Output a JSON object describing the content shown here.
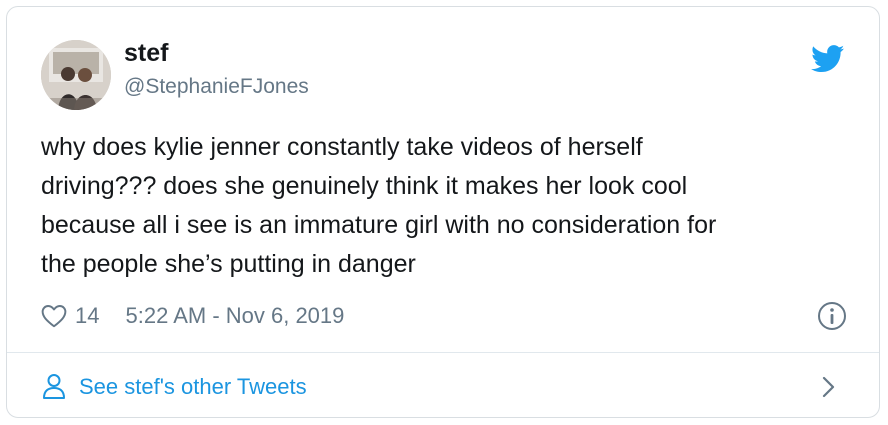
{
  "colors": {
    "twitter_blue": "#1da1f2",
    "link_blue": "#1b95e0",
    "text": "#14171a",
    "muted": "#657786",
    "border": "#d9dee2"
  },
  "author": {
    "name": "stef",
    "handle": "@StephanieFJones",
    "avatar_icon": "profile-photo"
  },
  "tweet": {
    "text": "why does kylie jenner constantly take videos of herself\ndriving??? does she genuinely think it makes her look cool\nbecause all i see is an immature girl with no consideration for\nthe people she’s putting in danger"
  },
  "meta": {
    "like_icon": "heart-icon",
    "like_count": "14",
    "timestamp": "5:22 AM - Nov 6, 2019",
    "info_icon": "info-icon"
  },
  "footer": {
    "label": "See stef's other Tweets",
    "person_icon": "person-icon",
    "chevron_icon": "chevron-right-icon"
  },
  "brand": {
    "logo_icon": "twitter-bird-icon"
  }
}
